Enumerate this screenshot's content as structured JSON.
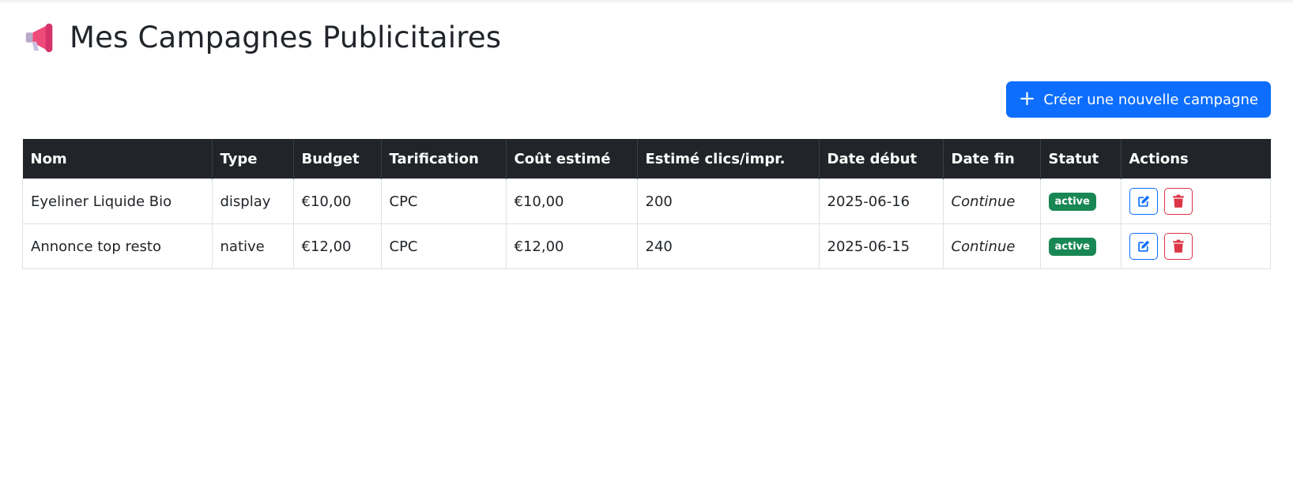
{
  "page": {
    "title": "Mes Campagnes Publicitaires",
    "title_icon": "megaphone-icon"
  },
  "toolbar": {
    "create_label": "Créer une nouvelle campagne",
    "create_icon": "plus-icon"
  },
  "table": {
    "headers": [
      "Nom",
      "Type",
      "Budget",
      "Tarification",
      "Coût estimé",
      "Estimé clics/impr.",
      "Date début",
      "Date fin",
      "Statut",
      "Actions"
    ],
    "rows": [
      {
        "nom": "Eyeliner Liquide Bio",
        "type": "display",
        "budget": "€10,00",
        "tarification": "CPC",
        "cout": "€10,00",
        "estime": "200",
        "date_debut": "2025-06-16",
        "date_fin": "Continue",
        "statut": "active"
      },
      {
        "nom": "Annonce top resto",
        "type": "native",
        "budget": "€12,00",
        "tarification": "CPC",
        "cout": "€12,00",
        "estime": "240",
        "date_debut": "2025-06-15",
        "date_fin": "Continue",
        "statut": "active"
      }
    ]
  },
  "colors": {
    "primary": "#0d6efd",
    "danger": "#dc3545",
    "success": "#198754",
    "header_bg": "#212529"
  },
  "icons": {
    "edit": "edit-icon",
    "delete": "trash-icon"
  }
}
